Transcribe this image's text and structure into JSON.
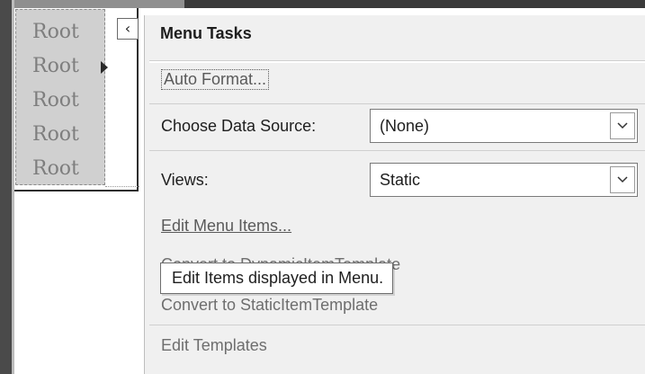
{
  "menu": {
    "items": [
      {
        "label": "Root"
      },
      {
        "label": "Root"
      },
      {
        "label": "Root"
      },
      {
        "label": "Root"
      },
      {
        "label": "Root"
      }
    ]
  },
  "smart_tag": {
    "glyph": "‹"
  },
  "tasks": {
    "title": "Menu Tasks",
    "auto_format": "Auto Format...",
    "data_source": {
      "label": "Choose Data Source:",
      "value": "(None)"
    },
    "views": {
      "label": "Views:",
      "value": "Static"
    },
    "edit_menu_items": "Edit Menu Items...",
    "convert_dynamic": "Convert to DynamicItemTemplate",
    "convert_static": "Convert to StaticItemTemplate",
    "edit_templates": "Edit Templates"
  },
  "tooltip": {
    "text": "Edit Items displayed in Menu."
  },
  "colors": {
    "panel_bg": "#f0f0f0",
    "menu_bg": "#d0d0d0",
    "disabled_text": "#6e6e6e"
  }
}
